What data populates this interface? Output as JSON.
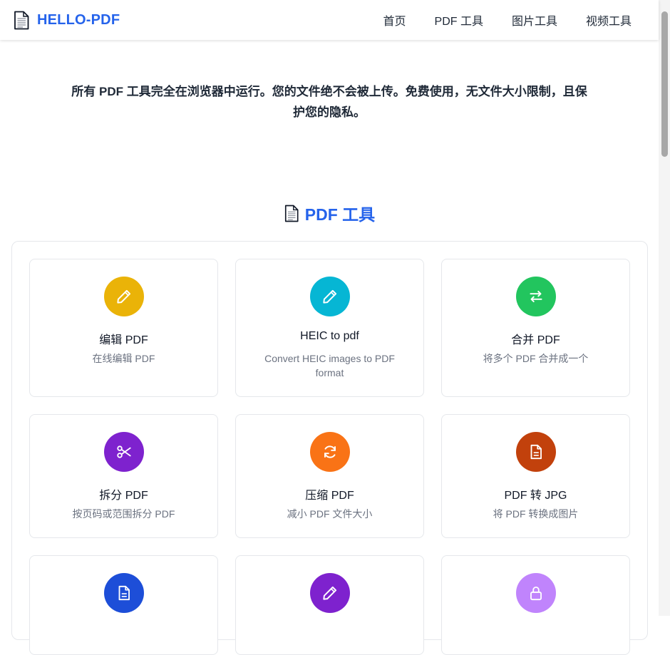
{
  "header": {
    "brand": "HELLO-PDF",
    "nav": [
      "首页",
      "PDF 工具",
      "图片工具",
      "视频工具"
    ]
  },
  "intro": {
    "line1": "所有 PDF 工具完全在浏览器中运行。您的文件绝不会被上传。免费使用，无文件大小限制，且保",
    "line2": "护您的隐私。"
  },
  "section": {
    "title": "PDF 工具"
  },
  "colors": {
    "accent": "#2563eb",
    "edit_pdf": "#eab308",
    "heic_to_pdf": "#06b6d4",
    "merge_pdf": "#22c55e",
    "split_pdf": "#7e22ce",
    "compress_pdf": "#f97316",
    "pdf_to_jpg": "#c2410c",
    "row3_1": "#1d4ed8",
    "row3_2": "#7e22ce",
    "row3_3": "#c084fc"
  },
  "tools": [
    {
      "name": "edit-pdf-card",
      "icon": "pencil-icon",
      "color": "#eab308",
      "title": "编辑 PDF",
      "desc": "在线编辑 PDF"
    },
    {
      "name": "heic-to-pdf-card",
      "icon": "pencil-icon",
      "color": "#06b6d4",
      "title": "HEIC to pdf",
      "desc": "Convert HEIC images to PDF format"
    },
    {
      "name": "merge-pdf-card",
      "icon": "swap-arrows-icon",
      "color": "#22c55e",
      "title": "合并 PDF",
      "desc": "将多个 PDF 合并成一个"
    },
    {
      "name": "split-pdf-card",
      "icon": "scissors-icon",
      "color": "#7e22ce",
      "title": "拆分 PDF",
      "desc": "按页码或范围拆分 PDF"
    },
    {
      "name": "compress-pdf-card",
      "icon": "refresh-icon",
      "color": "#f97316",
      "title": "压缩 PDF",
      "desc": "减小 PDF 文件大小"
    },
    {
      "name": "pdf-to-jpg-card",
      "icon": "file-text-icon",
      "color": "#c2410c",
      "title": "PDF 转 JPG",
      "desc": "将 PDF 转换成图片"
    },
    {
      "name": "tool-card-7",
      "icon": "file-text-icon",
      "color": "#1d4ed8",
      "title": "",
      "desc": ""
    },
    {
      "name": "tool-card-8",
      "icon": "pencil-icon",
      "color": "#7e22ce",
      "title": "",
      "desc": ""
    },
    {
      "name": "tool-card-9",
      "icon": "lock-icon",
      "color": "#c084fc",
      "title": "",
      "desc": ""
    }
  ]
}
